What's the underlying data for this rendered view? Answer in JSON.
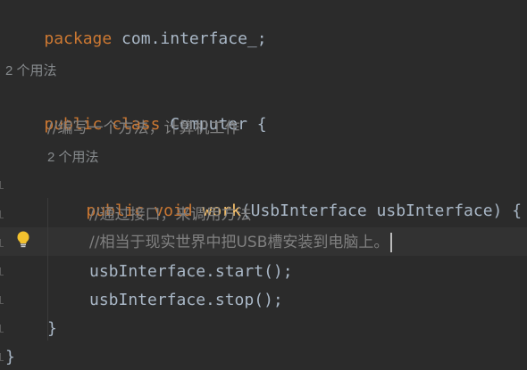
{
  "code": {
    "line_package": {
      "kw": "package",
      "rest": " com.interface_;"
    },
    "usage_hint_class": "2 个用法",
    "line_class": {
      "kw1": "public",
      "kw2": "class",
      "name": "Computer",
      "brace": " {"
    },
    "comment_method": "//编写一个方法，计算机工作",
    "usage_hint_method": "2 个用法",
    "line_method": {
      "kw1": "public",
      "kw2": "void",
      "fn": "work",
      "params": "(UsbInterface usbInterface) {"
    },
    "comment_1": "//通过接口，来调用方法",
    "comment_2": "//相当于现实世界中把USB槽安装到电脑上。",
    "call_start": "usbInterface.start();",
    "call_stop": "usbInterface.stop();",
    "close_method": "}",
    "close_class": "}"
  },
  "icons": {
    "intention": "lightbulb-icon"
  },
  "colors": {
    "background": "#2b2b2b",
    "keyword": "#cc7832",
    "function": "#ffc66d",
    "comment": "#808080",
    "text": "#a9b7c6"
  }
}
